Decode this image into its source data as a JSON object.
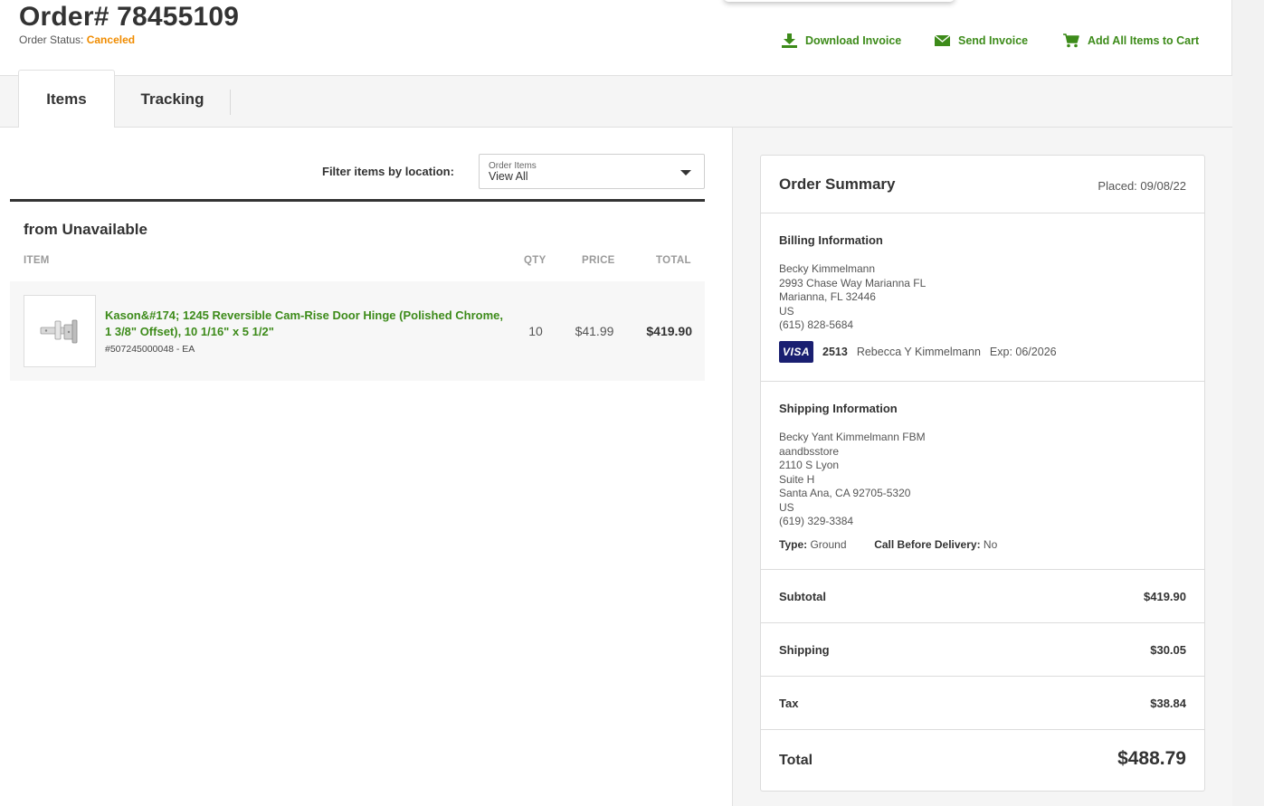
{
  "order": {
    "title": "Order# 78455109",
    "status_label": "Order Status:",
    "status_value": "Canceled"
  },
  "actions": {
    "download_invoice": "Download Invoice",
    "send_invoice": "Send Invoice",
    "add_all_to_cart": "Add All Items to Cart"
  },
  "tabs": [
    {
      "label": "Items",
      "active": true
    },
    {
      "label": "Tracking",
      "active": false
    }
  ],
  "filter": {
    "label": "Filter items by location:",
    "select_sublabel": "Order Items",
    "select_value": "View All"
  },
  "group": {
    "title": "from Unavailable",
    "columns": {
      "item": "ITEM",
      "qty": "QTY",
      "price": "PRICE",
      "total": "TOTAL"
    },
    "items": [
      {
        "name": "Kason&#174; 1245 Reversible Cam-Rise Door Hinge (Polished Chrome, 1 3/8\" Offset), 10 1/16\" x 5 1/2\"",
        "sku": "#507245000048 - EA",
        "qty": "10",
        "price": "$41.99",
        "total": "$419.90"
      }
    ]
  },
  "summary": {
    "title": "Order Summary",
    "placed": "Placed: 09/08/22",
    "billing": {
      "title": "Billing Information",
      "lines": [
        "Becky Kimmelmann",
        "2993 Chase Way Marianna FL",
        "Marianna, FL 32446",
        "US",
        "(615) 828-5684"
      ],
      "card_brand": "VISA",
      "card_last4": "2513",
      "card_name": "Rebecca Y Kimmelmann",
      "card_exp": "Exp: 06/2026"
    },
    "shipping": {
      "title": "Shipping Information",
      "lines": [
        "Becky Yant Kimmelmann FBM",
        "aandbsstore",
        "2110 S Lyon",
        "Suite H",
        "Santa Ana, CA 92705-5320",
        "US",
        "(619) 329-3384"
      ],
      "type_label": "Type:",
      "type_value": "Ground",
      "call_label": "Call Before Delivery:",
      "call_value": "No"
    },
    "totals": {
      "subtotal_label": "Subtotal",
      "subtotal": "$419.90",
      "shipping_label": "Shipping",
      "shipping": "$30.05",
      "tax_label": "Tax",
      "tax": "$38.84",
      "total_label": "Total",
      "total": "$488.79"
    }
  },
  "colors": {
    "accent_green": "#3d8b1a",
    "status_orange": "#f08c00",
    "visa_blue": "#1a1f71"
  },
  "icons": {
    "download": "download-icon",
    "send": "envelope-icon",
    "cart": "cart-icon",
    "dropdown": "caret-down-icon"
  }
}
